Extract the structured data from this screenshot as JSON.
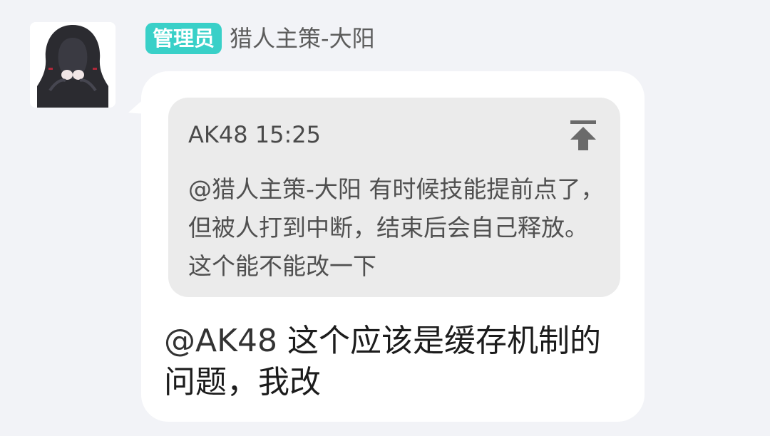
{
  "message": {
    "avatar_icon": "hooded-figure-avatar",
    "role_badge": "管理员",
    "sender_name": "猎人主策-大阳",
    "quote": {
      "author": "AK48",
      "time": "15:25",
      "text": "@猎人主策-大阳 有时候技能提前点了，但被人打到中断，结束后会自己释放。这个能不能改一下",
      "jump_icon": "jump-to-top-icon"
    },
    "reply": {
      "mention": "@AK48",
      "text": " 这个应该是缓存机制的问题，我改"
    }
  },
  "colors": {
    "badge": "#39d0c8",
    "background": "#f2f3f7",
    "bubble": "#ffffff",
    "quote_background": "#ebebeb"
  }
}
